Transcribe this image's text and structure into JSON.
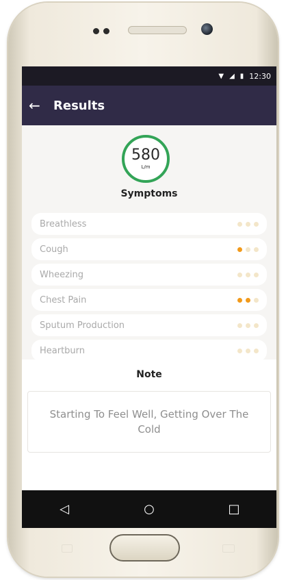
{
  "status_bar": {
    "time": "12:30",
    "icons": [
      "wifi-icon",
      "signal-icon",
      "battery-icon"
    ]
  },
  "app_bar": {
    "back_icon": "back-arrow-icon",
    "title": "Results"
  },
  "gauge": {
    "value": "580",
    "unit": "L/m",
    "color": "#33a457"
  },
  "symptoms": {
    "heading": "Symptoms",
    "items": [
      {
        "label": "Breathless",
        "rating": 0,
        "max": 3
      },
      {
        "label": "Cough",
        "rating": 1,
        "max": 3
      },
      {
        "label": "Wheezing",
        "rating": 0,
        "max": 3
      },
      {
        "label": "Chest Pain",
        "rating": 2,
        "max": 3
      },
      {
        "label": "Sputum Production",
        "rating": 0,
        "max": 3
      },
      {
        "label": "Heartburn",
        "rating": 0,
        "max": 3
      }
    ]
  },
  "note": {
    "heading": "Note",
    "text": "Starting To Feel Well, Getting Over The Cold"
  },
  "nav_bar": {
    "buttons": [
      "back-nav-icon",
      "home-nav-icon",
      "recents-nav-icon"
    ]
  },
  "colors": {
    "app_bar": "#302b47",
    "status_bar": "#1c1a24",
    "accent": "#f29a1b",
    "inactive_dot": "#f3e6c9"
  }
}
